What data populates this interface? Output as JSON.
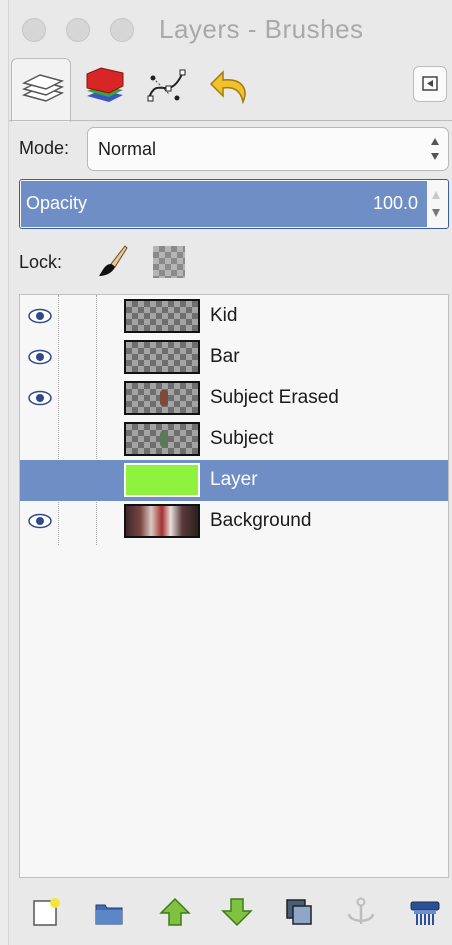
{
  "window": {
    "title": "Layers - Brushes"
  },
  "tabs": [
    {
      "name": "layers-tab",
      "icon": "layers-stack-icon",
      "active": true
    },
    {
      "name": "channels-tab",
      "icon": "channels-icon",
      "active": false
    },
    {
      "name": "paths-tab",
      "icon": "paths-icon",
      "active": false
    },
    {
      "name": "undo-history-tab",
      "icon": "undo-icon",
      "active": false
    }
  ],
  "tab_menu_icon": "tab-menu-icon",
  "mode": {
    "label": "Mode:",
    "value": "Normal"
  },
  "opacity": {
    "label": "Opacity",
    "value": "100.0",
    "fraction": 1.0
  },
  "lock": {
    "label": "Lock:",
    "icons": [
      "paintbrush-lock-icon",
      "alpha-lock-icon"
    ]
  },
  "layers": [
    {
      "name": "Kid",
      "visible": true,
      "thumbnail": "checker",
      "selected": false
    },
    {
      "name": "Bar",
      "visible": true,
      "thumbnail": "checker",
      "selected": false
    },
    {
      "name": "Subject Erased",
      "visible": true,
      "thumbnail": "checker",
      "selected": false
    },
    {
      "name": "Subject",
      "visible": false,
      "thumbnail": "checker",
      "selected": false
    },
    {
      "name": "Layer",
      "visible": false,
      "thumbnail": "green",
      "selected": true
    },
    {
      "name": "Background",
      "visible": true,
      "thumbnail": "photo",
      "selected": false
    }
  ],
  "toolbar": {
    "buttons": [
      {
        "name": "new-layer-button",
        "icon": "new-layer-icon"
      },
      {
        "name": "new-layer-group-button",
        "icon": "folder-icon"
      },
      {
        "name": "raise-layer-button",
        "icon": "arrow-up-icon"
      },
      {
        "name": "lower-layer-button",
        "icon": "arrow-down-icon"
      },
      {
        "name": "duplicate-layer-button",
        "icon": "duplicate-icon"
      },
      {
        "name": "anchor-layer-button",
        "icon": "anchor-icon",
        "disabled": true
      },
      {
        "name": "delete-layer-button",
        "icon": "delete-icon"
      }
    ]
  },
  "colors": {
    "selection": "#6f8ec6",
    "opacity_fill": "#6f8ec6",
    "arrow_green": "#7fc241",
    "layer_thumb_green": "#8ff23e"
  }
}
